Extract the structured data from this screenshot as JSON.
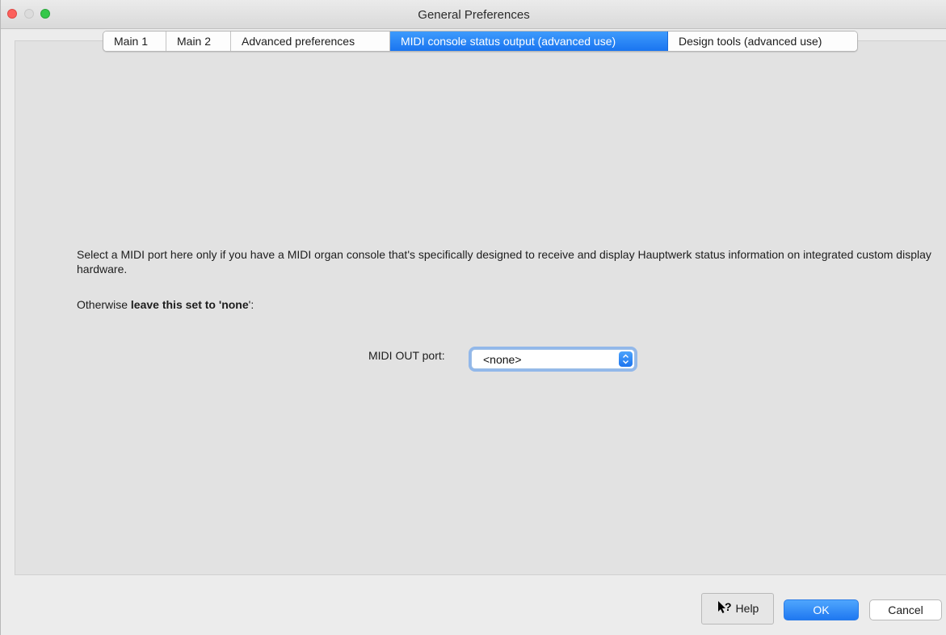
{
  "window": {
    "title": "General Preferences"
  },
  "tabs": [
    {
      "label": "Main 1",
      "selected": false
    },
    {
      "label": "Main 2",
      "selected": false
    },
    {
      "label": "Advanced preferences",
      "selected": false
    },
    {
      "label": "MIDI console status output (advanced use)",
      "selected": true
    },
    {
      "label": "Design tools (advanced use)",
      "selected": false
    }
  ],
  "content": {
    "description": "Select a MIDI port here only if you have a MIDI organ console that's specifically designed to receive and display Hauptwerk status information on integrated custom display hardware.",
    "otherwise_prefix": "Otherwise ",
    "otherwise_bold": "leave this set to '",
    "otherwise_none": "none",
    "otherwise_suffix": "':",
    "port_label": "MIDI OUT port:",
    "port_value": "<none>"
  },
  "buttons": {
    "help": "Help",
    "ok": "OK",
    "cancel": "Cancel"
  },
  "colors": {
    "accent": "#1a75f0",
    "close": "#fc605c",
    "zoom": "#34c84a"
  },
  "icons": {
    "help_icon": "arrow-question-icon",
    "stepper_icon": "up-down-chevron-icon"
  }
}
